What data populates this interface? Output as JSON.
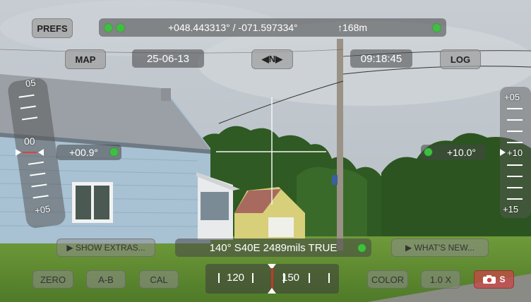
{
  "top_bar": {
    "coordinates": "+048.443313° / -071.597334°",
    "altitude": "↑168m"
  },
  "buttons": {
    "prefs": "PREFS",
    "map": "MAP",
    "log": "LOG",
    "show_extras": "▶ SHOW EXTRAS...",
    "whats_new": "▶ WHAT'S NEW...",
    "zero": "ZERO",
    "ab": "A-B",
    "cal": "CAL",
    "color": "COLOR",
    "zoom": "1.0 X",
    "camera_suffix": "S"
  },
  "date": "25-06-13",
  "north_toggle": "◀N▶",
  "time": "09:18:45",
  "roll_angle": "+00.9°",
  "pitch_angle": "+10.0°",
  "heading_readout": "140° S40E  2489mils  TRUE",
  "compass": {
    "left_value": "120",
    "right_value": "150"
  },
  "left_scale": {
    "top_label": "05",
    "zero_label": "00",
    "bottom_label": "+05"
  },
  "right_scale": {
    "top_label": "+05",
    "mid_label": "+10",
    "bottom_label": "+15"
  },
  "colors": {
    "status_green": "#3fbf3f",
    "compass_needle": "#c0392b",
    "camera_button": "#c84646"
  }
}
